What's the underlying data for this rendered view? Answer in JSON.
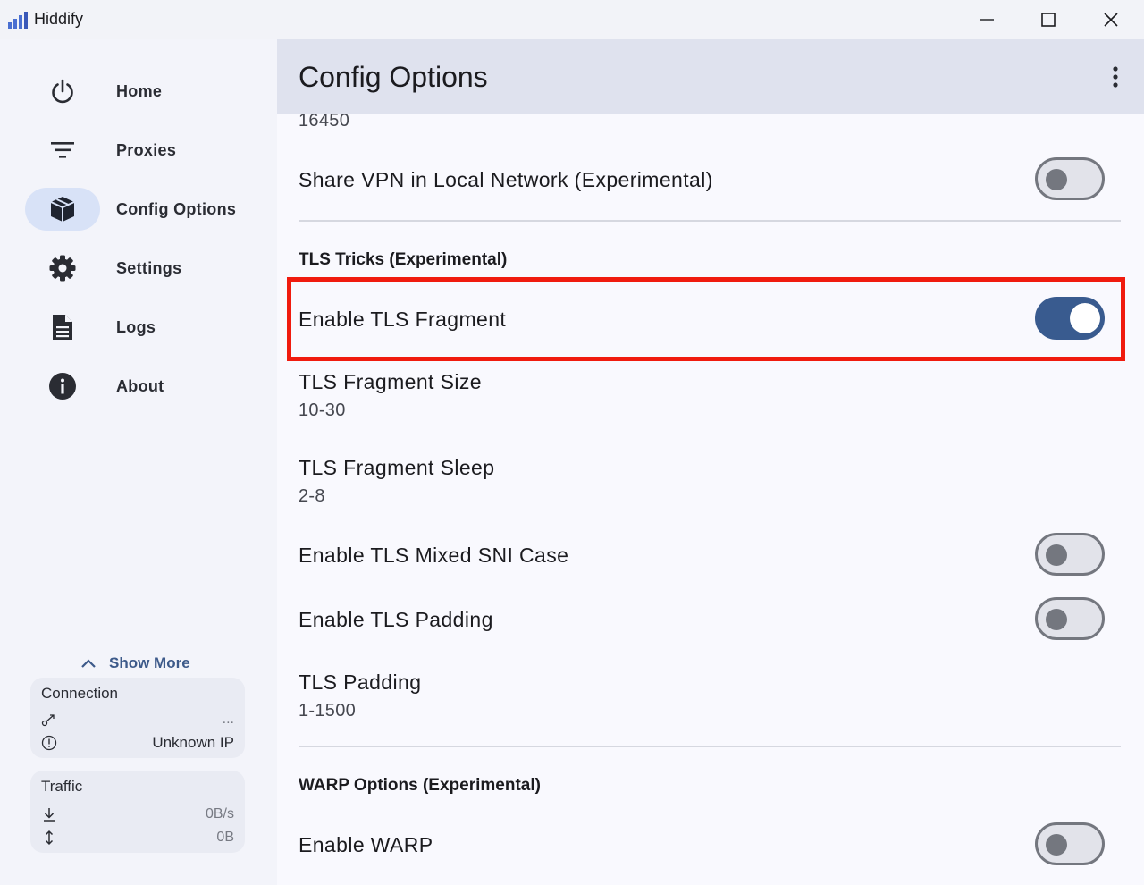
{
  "window": {
    "title": "Hiddify",
    "controls": {
      "minimize": "minimize-icon",
      "maximize": "maximize-icon",
      "close": "close-icon"
    }
  },
  "sidebar": {
    "items": [
      {
        "label": "Home",
        "icon": "power-icon",
        "active": false
      },
      {
        "label": "Proxies",
        "icon": "filter-list-icon",
        "active": false
      },
      {
        "label": "Config Options",
        "icon": "box-icon",
        "active": true
      },
      {
        "label": "Settings",
        "icon": "gear-icon",
        "active": false
      },
      {
        "label": "Logs",
        "icon": "document-icon",
        "active": false
      },
      {
        "label": "About",
        "icon": "info-icon",
        "active": false
      }
    ],
    "show_more": "Show More",
    "connection": {
      "title": "Connection",
      "link_value": "...",
      "ip_value": "Unknown IP"
    },
    "traffic": {
      "title": "Traffic",
      "speed": "0B/s",
      "total": "0B"
    }
  },
  "main": {
    "title": "Config Options",
    "partial_value": "16450",
    "share_vpn": {
      "label": "Share VPN in Local Network (Experimental)",
      "enabled": false
    },
    "tls_section": "TLS Tricks (Experimental)",
    "tls_fragment": {
      "label": "Enable TLS Fragment",
      "enabled": true
    },
    "fragment_size": {
      "label": "TLS Fragment Size",
      "value": "10-30"
    },
    "fragment_sleep": {
      "label": "TLS Fragment Sleep",
      "value": "2-8"
    },
    "mixed_sni": {
      "label": "Enable TLS Mixed SNI Case",
      "enabled": false
    },
    "tls_padding_toggle": {
      "label": "Enable TLS Padding",
      "enabled": false
    },
    "tls_padding": {
      "label": "TLS Padding",
      "value": "1-1500"
    },
    "warp_section": "WARP Options (Experimental)",
    "warp": {
      "label": "Enable WARP",
      "enabled": false
    }
  },
  "colors": {
    "accent": "#395b8f",
    "highlight_border": "#f01b0e",
    "active_nav_bg": "#d8e2f7",
    "appbar_bg": "#dfe2ee"
  }
}
